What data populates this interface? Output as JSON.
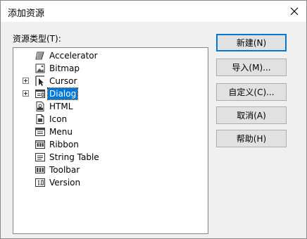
{
  "window": {
    "title": "添加资源"
  },
  "list": {
    "label": "资源类型(T):",
    "items": [
      {
        "label": "Accelerator",
        "icon": "accelerator-icon",
        "expander": false,
        "selected": false
      },
      {
        "label": "Bitmap",
        "icon": "bitmap-icon",
        "expander": false,
        "selected": false
      },
      {
        "label": "Cursor",
        "icon": "cursor-icon",
        "expander": true,
        "selected": false
      },
      {
        "label": "Dialog",
        "icon": "dialog-icon",
        "expander": true,
        "selected": true
      },
      {
        "label": "HTML",
        "icon": "html-icon",
        "expander": false,
        "selected": false
      },
      {
        "label": "Icon",
        "icon": "icon-file-icon",
        "expander": false,
        "selected": false
      },
      {
        "label": "Menu",
        "icon": "menu-icon",
        "expander": false,
        "selected": false
      },
      {
        "label": "Ribbon",
        "icon": "ribbon-icon",
        "expander": false,
        "selected": false
      },
      {
        "label": "String Table",
        "icon": "string-table-icon",
        "expander": false,
        "selected": false
      },
      {
        "label": "Toolbar",
        "icon": "toolbar-icon",
        "expander": false,
        "selected": false
      },
      {
        "label": "Version",
        "icon": "version-icon",
        "expander": false,
        "selected": false
      }
    ]
  },
  "buttons": {
    "new": "新建(N)",
    "import": "导入(M)...",
    "custom": "自定义(C)...",
    "cancel": "取消(A)",
    "help": "帮助(H)"
  },
  "colors": {
    "selection": "#0078d7",
    "dialog_bg": "#f0f0f0"
  }
}
